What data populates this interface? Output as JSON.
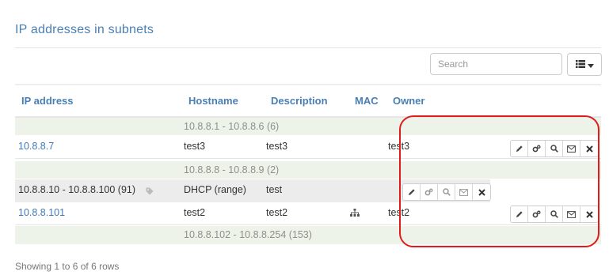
{
  "page": {
    "title": "IP addresses in subnets"
  },
  "toolbar": {
    "search_placeholder": "Search"
  },
  "table": {
    "headers": {
      "ip": "IP address",
      "hostname": "Hostname",
      "description": "Description",
      "mac": "MAC",
      "owner": "Owner"
    },
    "ranges": [
      "10.8.8.1 - 10.8.8.6 (6)",
      "10.8.8.8 - 10.8.8.9 (2)",
      "10.8.8.102 - 10.8.8.254 (153)"
    ],
    "rows": [
      {
        "ip": "10.8.8.7",
        "hostname": "test3",
        "description": "test3",
        "owner": "test3"
      },
      {
        "ip": "10.8.8.10 - 10.8.8.100 (91)",
        "hostname": "DHCP (range)",
        "description": "test",
        "owner": ""
      },
      {
        "ip": "10.8.8.101",
        "hostname": "test2",
        "description": "test2",
        "owner": "test2"
      }
    ]
  },
  "footer": {
    "text": "Showing 1 to 6 of 6 rows"
  },
  "colors": {
    "link": "#3d7ab8",
    "annotation": "#e01b1b",
    "range_bg": "#eef3ea"
  },
  "icons": [
    "pencil-icon",
    "cogs-icon",
    "search-icon",
    "envelope-icon",
    "close-icon",
    "list-icon",
    "caret-down-icon",
    "tag-icon",
    "sitemap-icon"
  ]
}
